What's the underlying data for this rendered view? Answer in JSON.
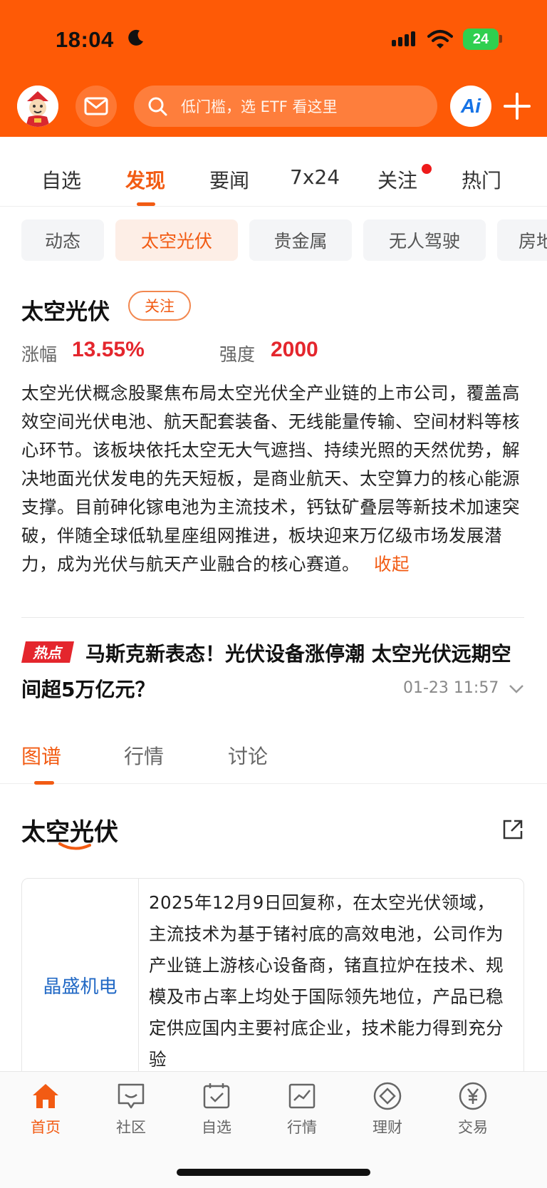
{
  "status": {
    "time": "18:04",
    "battery": "24"
  },
  "header": {
    "search_placeholder": "低门槛，选 ETF 看这里",
    "ai_label": "Ai"
  },
  "nav_tabs": [
    {
      "label": "自选"
    },
    {
      "label": "发现"
    },
    {
      "label": "要闻"
    },
    {
      "label": "7x24"
    },
    {
      "label": "关注"
    },
    {
      "label": "热门"
    }
  ],
  "chips": [
    {
      "label": "动态"
    },
    {
      "label": "太空光伏"
    },
    {
      "label": "贵金属"
    },
    {
      "label": "无人驾驶"
    },
    {
      "label": "房地"
    }
  ],
  "sector": {
    "title": "太空光伏",
    "follow_label": "关注",
    "change_label": "涨幅",
    "change_value": "13.55%",
    "strength_label": "强度",
    "strength_value": "2000",
    "description": "太空光伏概念股聚焦布局太空光伏全产业链的上市公司，覆盖高效空间光伏电池、航天配套装备、无线能量传输、空间材料等核心环节。该板块依托太空无大气遮挡、持续光照的天然优势，解决地面光伏发电的先天短板，是商业航天、太空算力的核心能源支撑。目前砷化镓电池为主流技术，钙钛矿叠层等新技术加速突破，伴随全球低轨星座组网推进，板块迎来万亿级市场发展潜力，成为光伏与航天产业融合的核心赛道。",
    "collapse_label": "收起"
  },
  "hot_news": {
    "tag": "热点",
    "headline": "马斯克新表态！光伏设备涨停潮 太空光伏远期空间超5万亿元？",
    "time": "01-23 11:57"
  },
  "sub_tabs": [
    {
      "label": "图谱"
    },
    {
      "label": "行情"
    },
    {
      "label": "讨论"
    }
  ],
  "map": {
    "title": "太空光伏",
    "company": "晶盛机电",
    "text": "2025年12月9日回复称，在太空光伏领域，主流技术为基于锗衬底的高效电池，公司作为产业链上游核心设备商，锗直拉炉在技术、规模及市占率上均处于国际领先地位，产品已稳定供应国内主要衬底企业，技术能力得到充分验"
  },
  "tabbar": [
    {
      "label": "首页",
      "icon": "home-icon"
    },
    {
      "label": "社区",
      "icon": "chat-icon"
    },
    {
      "label": "自选",
      "icon": "watchlist-icon"
    },
    {
      "label": "行情",
      "icon": "chart-icon"
    },
    {
      "label": "理财",
      "icon": "diamond-icon"
    },
    {
      "label": "交易",
      "icon": "yen-icon"
    }
  ],
  "colors": {
    "brand": "#fe5a06",
    "accent": "#f25b13",
    "rise": "#e4262d",
    "link": "#2269c5"
  }
}
